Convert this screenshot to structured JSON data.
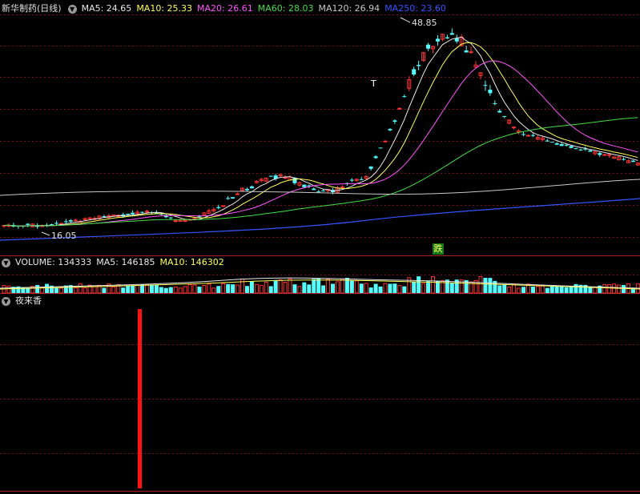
{
  "main_panel": {
    "stock_title": "新华制药(日线)",
    "ma_legend": [
      {
        "label": "MA5: 24.65",
        "color": "#e8e8e8"
      },
      {
        "label": "MA10: 25.33",
        "color": "#ffff55"
      },
      {
        "label": "MA20: 26.61",
        "color": "#ff55ff"
      },
      {
        "label": "MA60: 28.03",
        "color": "#44dd44"
      },
      {
        "label": "MA120: 26.94",
        "color": "#c8c8c8"
      },
      {
        "label": "MA250: 23.60",
        "color": "#3355ff"
      }
    ],
    "high_label": "48.85",
    "low_label": "16.05",
    "drop_badge": "跌",
    "t_marker": "T"
  },
  "volume_panel": {
    "legend": [
      {
        "label": "VOLUME: 134333",
        "color": "#e8e8e8"
      },
      {
        "label": "MA5: 146185",
        "color": "#e8e8e8"
      },
      {
        "label": "MA10: 146302",
        "color": "#ffff55"
      }
    ]
  },
  "indicator_panel": {
    "title": "夜来香"
  },
  "colors": {
    "up": "#ff3333",
    "down": "#55ffff",
    "grid": "#7a1010",
    "border": "#aa2222",
    "signal": "#ff1111"
  }
}
